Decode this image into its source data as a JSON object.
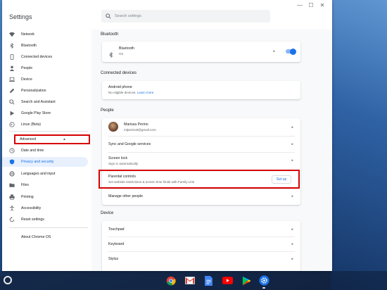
{
  "app": {
    "title": "Settings"
  },
  "search": {
    "placeholder": "Search settings"
  },
  "window_controls": {
    "minimize": "—",
    "maximize": "☐",
    "close": "✕"
  },
  "sidebar": {
    "items": [
      {
        "label": "Network",
        "icon": "wifi-icon"
      },
      {
        "label": "Bluetooth",
        "icon": "bluetooth-icon"
      },
      {
        "label": "Connected devices",
        "icon": "phone-icon"
      },
      {
        "label": "People",
        "icon": "person-icon"
      },
      {
        "label": "Device",
        "icon": "laptop-icon"
      },
      {
        "label": "Personalization",
        "icon": "pencil-icon"
      },
      {
        "label": "Search and Assistant",
        "icon": "search-icon"
      },
      {
        "label": "Google Play Store",
        "icon": "play-store-icon"
      },
      {
        "label": "Linux (Beta)",
        "icon": "terminal-icon"
      }
    ],
    "advanced": {
      "label": "Advanced",
      "chevron": "▲"
    },
    "advanced_items": [
      {
        "label": "Date and time",
        "icon": "clock-icon"
      },
      {
        "label": "Privacy and security",
        "icon": "shield-icon",
        "active": true
      },
      {
        "label": "Languages and input",
        "icon": "globe-icon"
      },
      {
        "label": "Files",
        "icon": "folder-icon"
      },
      {
        "label": "Printing",
        "icon": "printer-icon"
      },
      {
        "label": "Accessibility",
        "icon": "accessibility-icon"
      },
      {
        "label": "Reset settings",
        "icon": "reset-icon"
      }
    ],
    "about": "About Chrome OS"
  },
  "main": {
    "bluetooth": {
      "heading": "Bluetooth",
      "title": "Bluetooth",
      "status": "On",
      "toggle_on": true
    },
    "connected_devices": {
      "heading": "Connected devices",
      "title": "Android phone",
      "sub": "No eligible devices.",
      "link": "Learn more"
    },
    "people": {
      "heading": "People",
      "account_name": "Marissa Perino",
      "account_email": "mlperino9@gmail.com",
      "sync": "Sync and Google services",
      "screen_lock_title": "Screen lock",
      "screen_lock_sub": "Sign in automatically",
      "parental_title": "Parental controls",
      "parental_sub": "Set website restrictions & screen time limits with Family Link",
      "setup_label": "Set up",
      "manage": "Manage other people"
    },
    "device": {
      "heading": "Device",
      "items": [
        "Touchpad",
        "Keyboard",
        "Stylus"
      ]
    }
  },
  "arrow_glyph": "▸",
  "shelf": {
    "apps": [
      "chrome-icon",
      "gmail-icon",
      "docs-icon",
      "youtube-icon",
      "play-store-icon",
      "settings-icon"
    ]
  },
  "colors": {
    "accent": "#1a73e8",
    "highlight_border": "#d50000",
    "active_nav_bg": "#e8f0fe"
  }
}
